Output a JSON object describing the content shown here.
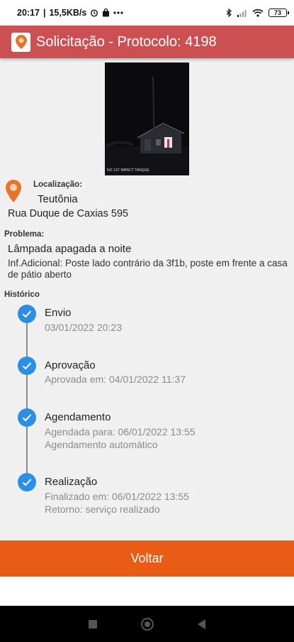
{
  "status_bar": {
    "time": "20:17",
    "speed": "15,5KB/s",
    "battery": "73",
    "icons": [
      "alarm-icon",
      "bag-icon",
      "more-dots-icon",
      "bluetooth-icon",
      "signal-icon",
      "wifi-icon",
      "battery-icon"
    ]
  },
  "header": {
    "title": "Solicitação - Protocolo: 4198",
    "color": "#cc4f52"
  },
  "photo": {
    "caption": "NO 1ST\nIMPACT TANQUE"
  },
  "location": {
    "label": "Localização:",
    "city": "Teutônia",
    "street": "Rua Duque de Caxias  595"
  },
  "problem": {
    "label": "Problema:",
    "title": "Lâmpada apagada a noite",
    "info": "Inf.Adicional: Poste lado contrário da 3f1b, poste em frente a casa de pátio aberto"
  },
  "history": {
    "label": "Histórico",
    "steps": [
      {
        "title": "Envio",
        "lines": [
          "03/01/2022 20:23"
        ]
      },
      {
        "title": "Aprovação",
        "lines": [
          "Aprovada em: 04/01/2022 11:37"
        ]
      },
      {
        "title": "Agendamento",
        "lines": [
          "Agendada para: 06/01/2022 13:55",
          "Agendamento automático"
        ]
      },
      {
        "title": "Realização",
        "lines": [
          "Finalizado em: 06/01/2022 13:55",
          "Retorno: serviço realizado"
        ]
      }
    ],
    "check_color": "#2c8fe6"
  },
  "footer": {
    "back_label": "Voltar",
    "color": "#e85c16"
  }
}
